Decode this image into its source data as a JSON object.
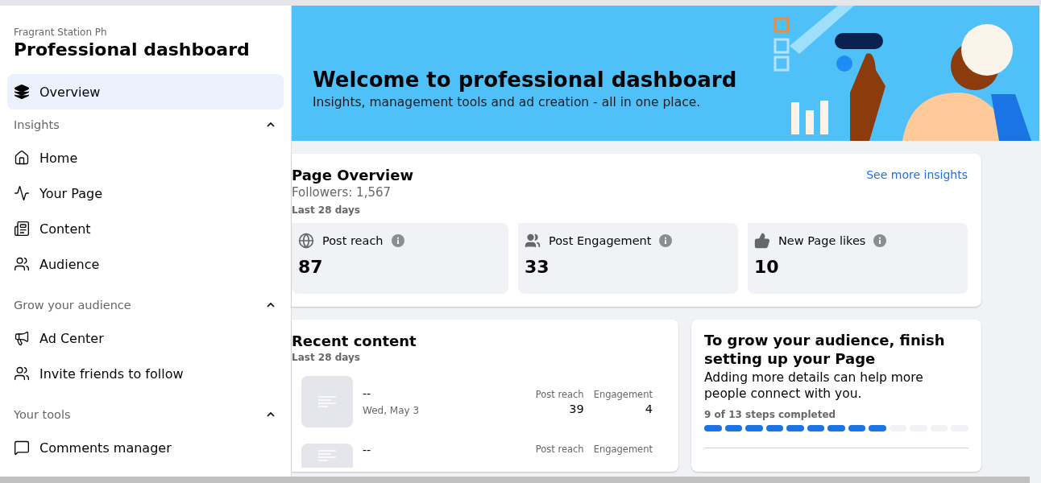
{
  "sidebar": {
    "page_name": "Fragrant Station Ph",
    "title": "Professional dashboard",
    "items": [
      {
        "kind": "item",
        "label": "Overview",
        "selected": true
      },
      {
        "kind": "section",
        "label": "Insights",
        "expanded": true
      },
      {
        "kind": "item",
        "label": "Home",
        "selected": false
      },
      {
        "kind": "item",
        "label": "Your Page",
        "selected": false
      },
      {
        "kind": "item",
        "label": "Content",
        "selected": false
      },
      {
        "kind": "item",
        "label": "Audience",
        "selected": false
      },
      {
        "kind": "section",
        "label": "Grow your audience",
        "expanded": true
      },
      {
        "kind": "item",
        "label": "Ad Center",
        "selected": false
      },
      {
        "kind": "item",
        "label": "Invite friends to follow",
        "selected": false
      },
      {
        "kind": "section",
        "label": "Your tools",
        "expanded": true
      },
      {
        "kind": "item",
        "label": "Comments manager",
        "selected": false
      }
    ]
  },
  "banner": {
    "title": "Welcome to professional dashboard",
    "subtitle": "Insights, management tools and ad creation - all in one place."
  },
  "page_overview": {
    "title": "Page Overview",
    "link": "See more insights",
    "followers": "Followers: 1,567",
    "period": "Last 28 days",
    "stats": [
      {
        "label": "Post reach",
        "value": "87"
      },
      {
        "label": "Post Engagement",
        "value": "33"
      },
      {
        "label": "New Page likes",
        "value": "10"
      }
    ]
  },
  "recent_content": {
    "title": "Recent content",
    "period": "Last 28 days",
    "posts": [
      {
        "title": "--",
        "date": "Wed, May 3",
        "reach_label": "Post reach",
        "reach": "39",
        "engagement_label": "Engagement",
        "engagement": "4"
      },
      {
        "title": "--",
        "reach_label": "Post reach",
        "engagement_label": "Engagement"
      }
    ]
  },
  "setup": {
    "title": "To grow your audience, finish setting up your Page",
    "text": "Adding more details can help more people connect with you.",
    "progress": "9 of 13 steps completed",
    "steps": [
      {
        "completed": true
      },
      {
        "completed": true
      },
      {
        "completed": true
      },
      {
        "completed": true
      },
      {
        "completed": true
      },
      {
        "completed": true
      },
      {
        "completed": true
      },
      {
        "completed": true
      },
      {
        "completed": true
      },
      {
        "completed": false
      },
      {
        "completed": false
      },
      {
        "completed": false
      },
      {
        "completed": false
      }
    ]
  }
}
